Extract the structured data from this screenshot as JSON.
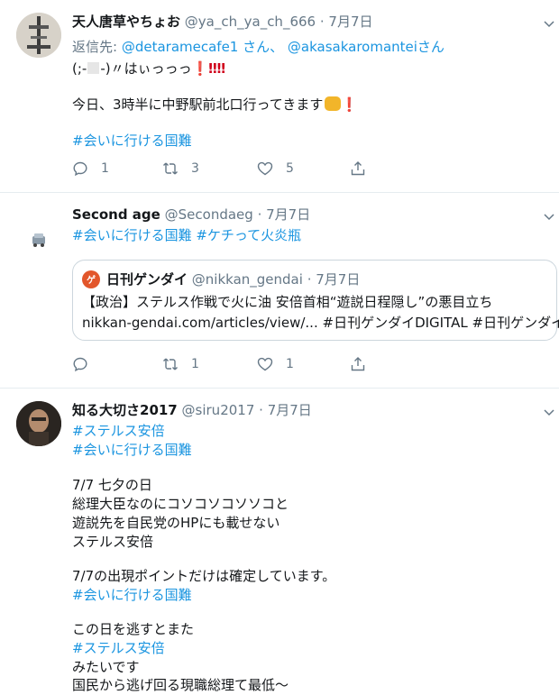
{
  "tweets": [
    {
      "name": "天人唐草やちょお",
      "handle": "@ya_ch_ya_ch_666",
      "dot": "·",
      "date": "7月7日",
      "reply_prefix": "返信先: ",
      "reply_user1": "@detaramecafe1",
      "reply_mid": " さん、 ",
      "reply_user2": "@akasakaromantei",
      "reply_suffix": "さん",
      "line1_a": "(;-",
      "line1_b": "-)〃はぃっっっ",
      "line1_excl": "❗‼‼",
      "line2": "今日、3時半に中野駅前北口行ってきます",
      "line2_excl": "❗",
      "hashtag": "#会いに行ける国難",
      "reply_count": "1",
      "retweet_count": "3",
      "like_count": "5"
    },
    {
      "name": "Second age",
      "handle": "@Secondaeg",
      "dot": "·",
      "date": "7月7日",
      "hashtag1": "#会いに行ける国難",
      "hashtag2": "#ケチって火炎瓶",
      "quote": {
        "logo_text": "ゲ",
        "name": "日刊ゲンダイ",
        "handle": "@nikkan_gendai",
        "dot": "·",
        "date": "7月7日",
        "line1": "【政治】ステルス作戦で火に油 安倍首相“遊説日程隠し”の悪目立ち",
        "line2_link": "nikkan-gendai.com/articles/view/...",
        "line2_tag1": "#日刊ゲンダイDIGITAL",
        "line2_tag2": "#日刊ゲンダイ"
      },
      "reply_count": "",
      "retweet_count": "1",
      "like_count": "1"
    },
    {
      "name": "知る大切さ2017",
      "handle": "@siru2017",
      "dot": "·",
      "date": "7月7日",
      "hashtag1": "#ステルス安倍",
      "hashtag2": "#会いに行ける国難",
      "body1": "7/7  七夕の日",
      "body2": "総理大臣なのにコソコソコソソコと",
      "body3": "遊説先を自民党のHPにも載せない",
      "body4": "ステルス安倍",
      "body5": "7/7の出現ポイントだけは確定しています。",
      "hashtag3": "#会いに行ける国難",
      "body6": "この日を逃すとまた",
      "hashtag4": "#ステルス安倍",
      "body7": "みたいです",
      "body8": "国民から逃げ回る現職総理て最低～"
    }
  ],
  "colors": {
    "link": "#1b95e0",
    "muted": "#657786",
    "divider": "#e6ecf0"
  }
}
